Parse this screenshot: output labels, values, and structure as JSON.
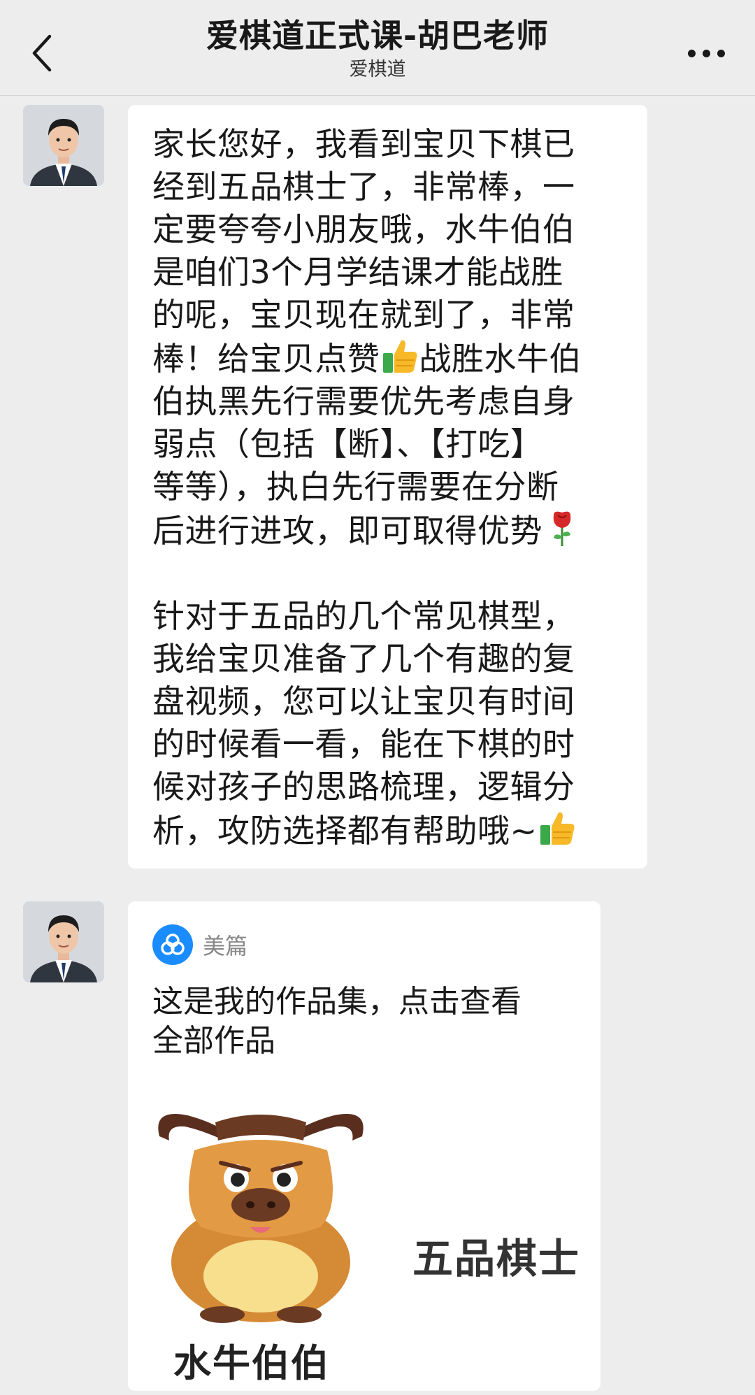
{
  "header": {
    "title": "爱棋道正式课-胡巴老师",
    "subtitle": "爱棋道",
    "back_icon": "chevron-left-icon",
    "more_icon": "more-dots-icon"
  },
  "messages": [
    {
      "type": "text",
      "sender_avatar": "teacher-avatar",
      "paragraphs": [
        {
          "before_thumb": "家长您好，我看到宝贝下棋已\n经到五品棋士了，非常棒，一\n定要夸夸小朋友哦，水牛伯伯\n是咱们3个月学结课才能战胜\n的呢，宝贝现在就到了，非常\n棒！给宝贝点赞",
          "after_thumb": "战胜水牛伯\n伯执黑先行需要优先考虑自身\n弱点（包括【断】、【打吃】\n等等），执白先行需要在分断\n后进行进攻，即可取得优势",
          "emojis": [
            "thumbs-up",
            "rose"
          ]
        },
        {
          "text": "针对于五品的几个常见棋型，\n我给宝贝准备了几个有趣的复\n盘视频，您可以让宝贝有时间\n的时候看一看，能在下棋的时\n候对孩子的思路梳理，逻辑分\n析，攻防选择都有帮助哦~",
          "emojis": [
            "thumbs-up"
          ]
        }
      ]
    },
    {
      "type": "link-card",
      "sender_avatar": "teacher-avatar",
      "source": {
        "name": "美篇",
        "icon": "meipian-logo-icon",
        "color": "#1a8cff"
      },
      "text": "这是我的作品集，点击查看\n全部作品",
      "thumbnail": {
        "image": "buffalo-mascot",
        "caption_right": "五品棋士",
        "caption_bottom": "水牛伯伯"
      }
    }
  ]
}
